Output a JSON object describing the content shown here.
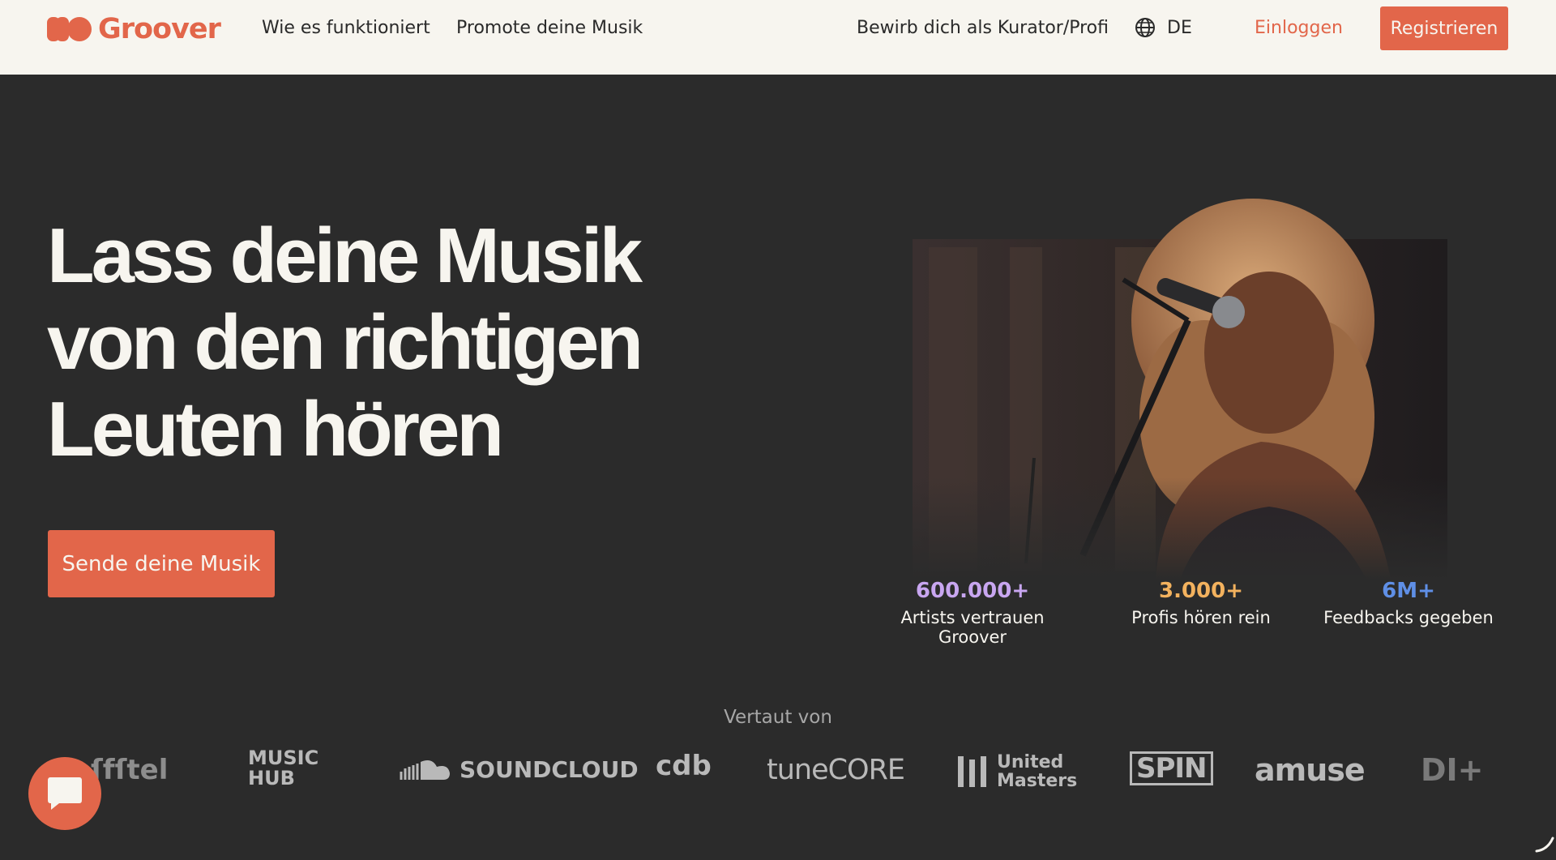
{
  "header": {
    "brand": "Groover",
    "nav": {
      "how_it_works": "Wie es funktioniert",
      "promote": "Promote deine Musik",
      "curator": "Bewirb dich als Kurator/Profi"
    },
    "language": "DE",
    "login": "Einloggen",
    "register": "Registrieren"
  },
  "hero": {
    "title_lines": [
      "Lass deine Musik",
      "von den richtigen",
      "Leuten hören"
    ],
    "cta": "Sende deine Musik"
  },
  "stats": [
    {
      "value": "600.000+",
      "label": "Artists vertrauen Groover",
      "color": "#c8a6f0"
    },
    {
      "value": "3.000+",
      "label": "Profis hören rein",
      "color": "#f3b25e"
    },
    {
      "value": "6M+",
      "label": "Feedbacks gegeben",
      "color": "#5f8fe6"
    }
  ],
  "trusted": {
    "label": "Vertaut von",
    "logos": [
      "ſfſtel",
      "MUSIC HUB",
      "SOUNDCLOUD",
      "cdb",
      "tuneCORE",
      "United Masters",
      "SPIN",
      "amuse",
      "DI+"
    ]
  },
  "colors": {
    "accent": "#e2664a",
    "background": "#2b2b2b",
    "nav_bg": "#f7f5ef"
  },
  "icons": {
    "language": "globe-icon",
    "chat": "chat-bubble-icon"
  }
}
